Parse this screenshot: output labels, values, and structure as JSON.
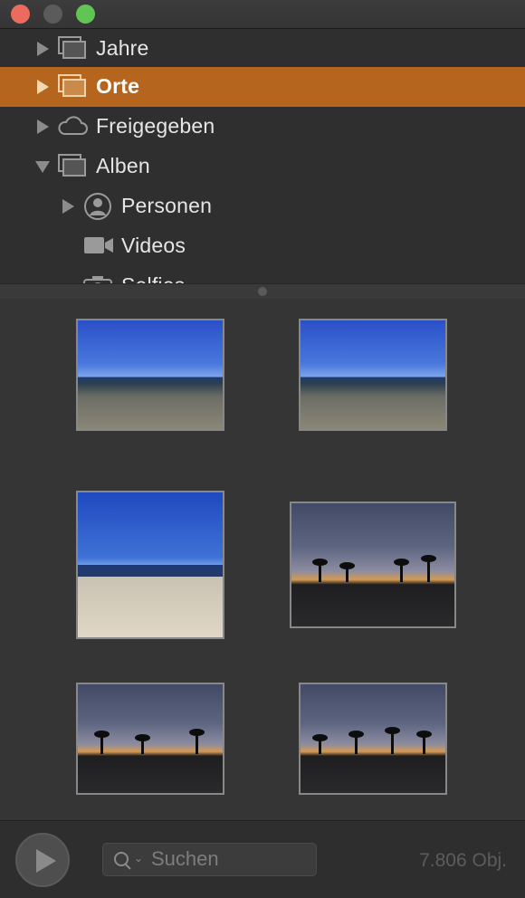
{
  "window": {
    "controls": [
      "close",
      "minimize",
      "maximize"
    ]
  },
  "sidebar": {
    "items": [
      {
        "label": "Jahre",
        "icon": "photo-stack-icon",
        "expanded": false,
        "selected": false
      },
      {
        "label": "Orte",
        "icon": "photo-stack-icon",
        "expanded": false,
        "selected": true
      },
      {
        "label": "Freigegeben",
        "icon": "cloud-icon",
        "expanded": false,
        "selected": false
      },
      {
        "label": "Alben",
        "icon": "photo-stack-icon",
        "expanded": true,
        "selected": false
      },
      {
        "label": "Personen",
        "icon": "person-icon",
        "expanded": false,
        "selected": false
      },
      {
        "label": "Videos",
        "icon": "video-camera-icon",
        "selected": false
      },
      {
        "label": "Selfies",
        "icon": "camera-icon",
        "selected": false
      }
    ]
  },
  "grid": {
    "photos": [
      {
        "scene": "beach"
      },
      {
        "scene": "beach"
      },
      {
        "scene": "pier"
      },
      {
        "scene": "sunset-promenade"
      },
      {
        "scene": "sunset-promenade"
      },
      {
        "scene": "sunset-palms"
      }
    ]
  },
  "bottom": {
    "search_placeholder": "Suchen",
    "count": "7.806 Obj."
  },
  "colors": {
    "selection": "#b5651d",
    "background": "#333333"
  }
}
